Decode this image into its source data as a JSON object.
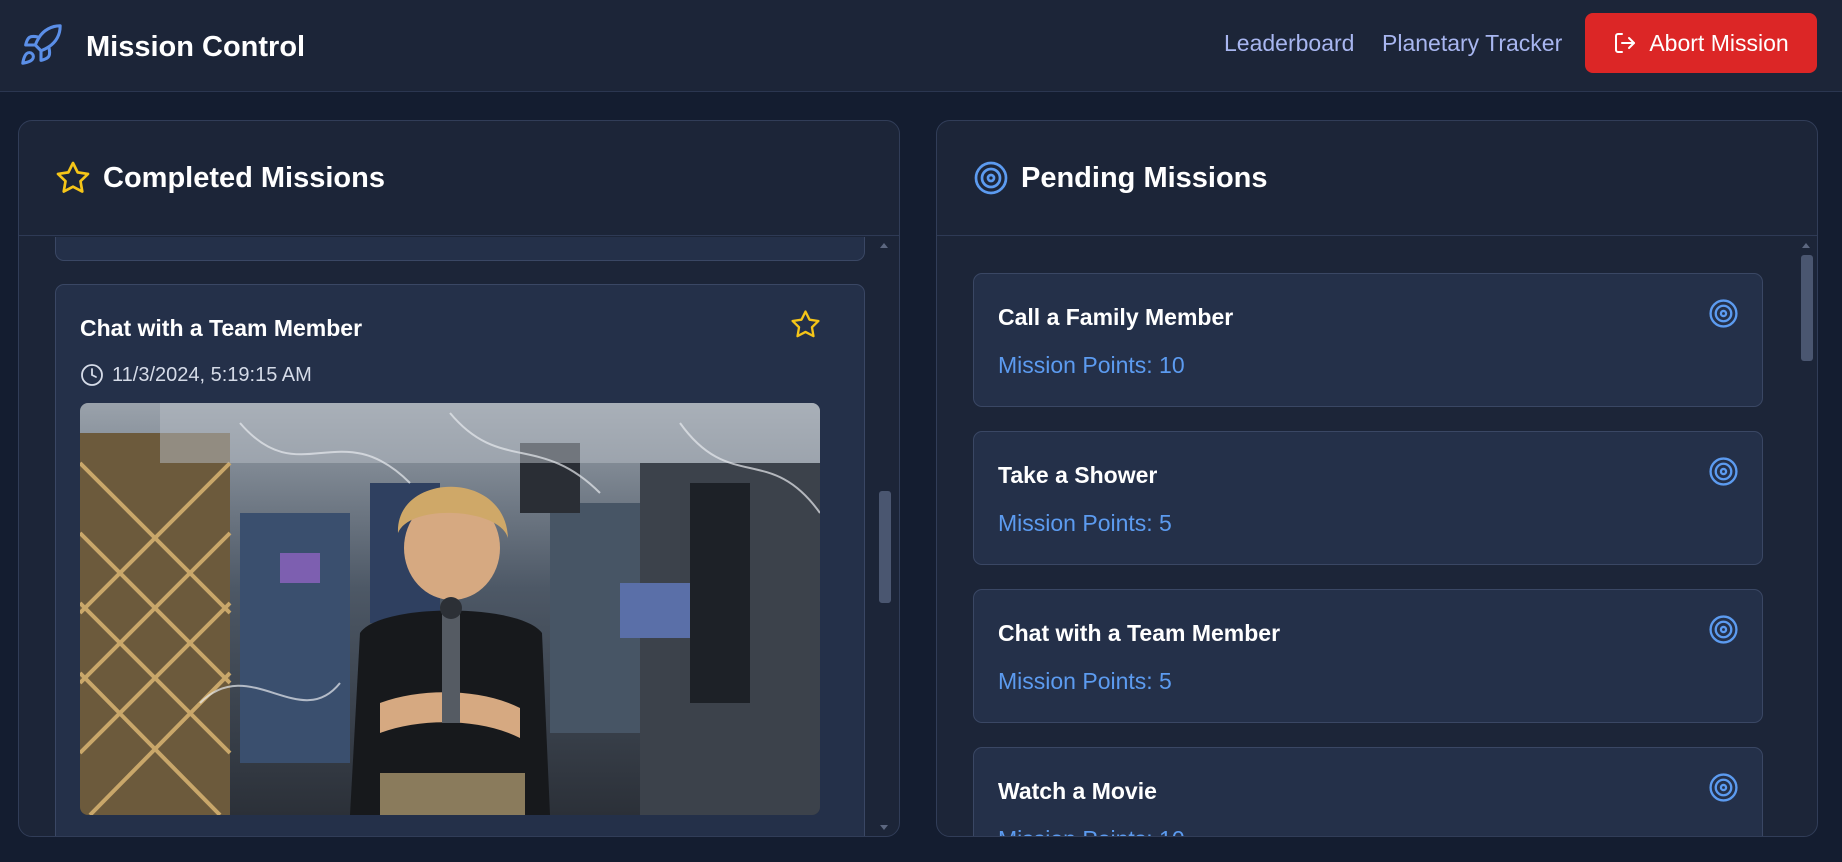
{
  "header": {
    "title": "Mission Control",
    "nav": [
      "Leaderboard",
      "Planetary Tracker"
    ],
    "abort_label": "Abort Mission"
  },
  "completed": {
    "title": "Completed Missions",
    "card": {
      "title": "Chat with a Team Member",
      "timestamp": "11/3/2024, 5:19:15 AM"
    }
  },
  "pending": {
    "title": "Pending Missions",
    "missions": [
      {
        "title": "Call a Family Member",
        "points": "Mission Points: 10"
      },
      {
        "title": "Take a Shower",
        "points": "Mission Points: 5"
      },
      {
        "title": "Chat with a Team Member",
        "points": "Mission Points: 5"
      },
      {
        "title": "Watch a Movie",
        "points": "Mission Points: 10"
      }
    ]
  },
  "colors": {
    "background": "#141d30",
    "panel": "#1c2538",
    "accent_blue": "#5c9bf0",
    "star_yellow": "#f5c518",
    "abort_red": "#dc2626"
  },
  "icons": [
    "rocket-icon",
    "logout-icon",
    "star-icon",
    "target-icon",
    "clock-icon"
  ]
}
